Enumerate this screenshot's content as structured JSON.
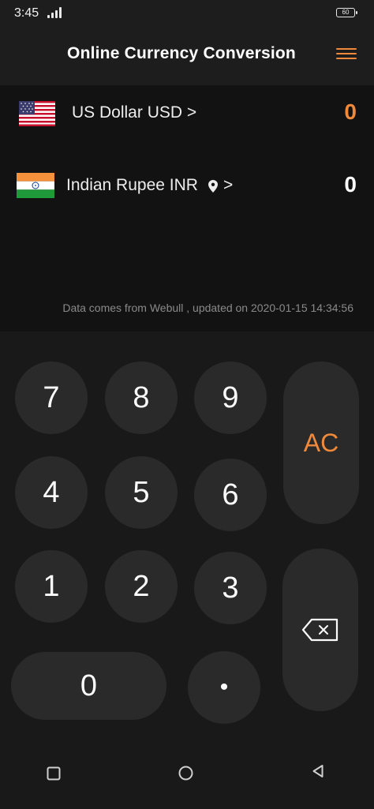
{
  "status_bar": {
    "time": "3:45",
    "battery": "60"
  },
  "header": {
    "title": "Online Currency Conversion"
  },
  "currencies": [
    {
      "label": "US Dollar USD >",
      "value": "0",
      "value_color": "#f08a3a"
    },
    {
      "label": "Indian Rupee INR",
      "suffix": ">",
      "value": "0",
      "value_color": "#ffffff"
    }
  ],
  "source_note": "Data comes from Webull , updated on 2020-01-15 14:34:56",
  "keypad": {
    "k7": "7",
    "k8": "8",
    "k9": "9",
    "k4": "4",
    "k5": "5",
    "k6": "6",
    "k1": "1",
    "k2": "2",
    "k3": "3",
    "k0": "0",
    "dot": "•",
    "ac": "AC"
  },
  "colors": {
    "accent": "#f08a3a",
    "background": "#191919",
    "panel": "#121212",
    "key": "#2a2a2a"
  },
  "icons": [
    "menu-icon",
    "us-flag-icon",
    "india-flag-icon",
    "location-pin-icon",
    "backspace-icon",
    "recent-apps-icon",
    "home-icon",
    "back-icon"
  ]
}
